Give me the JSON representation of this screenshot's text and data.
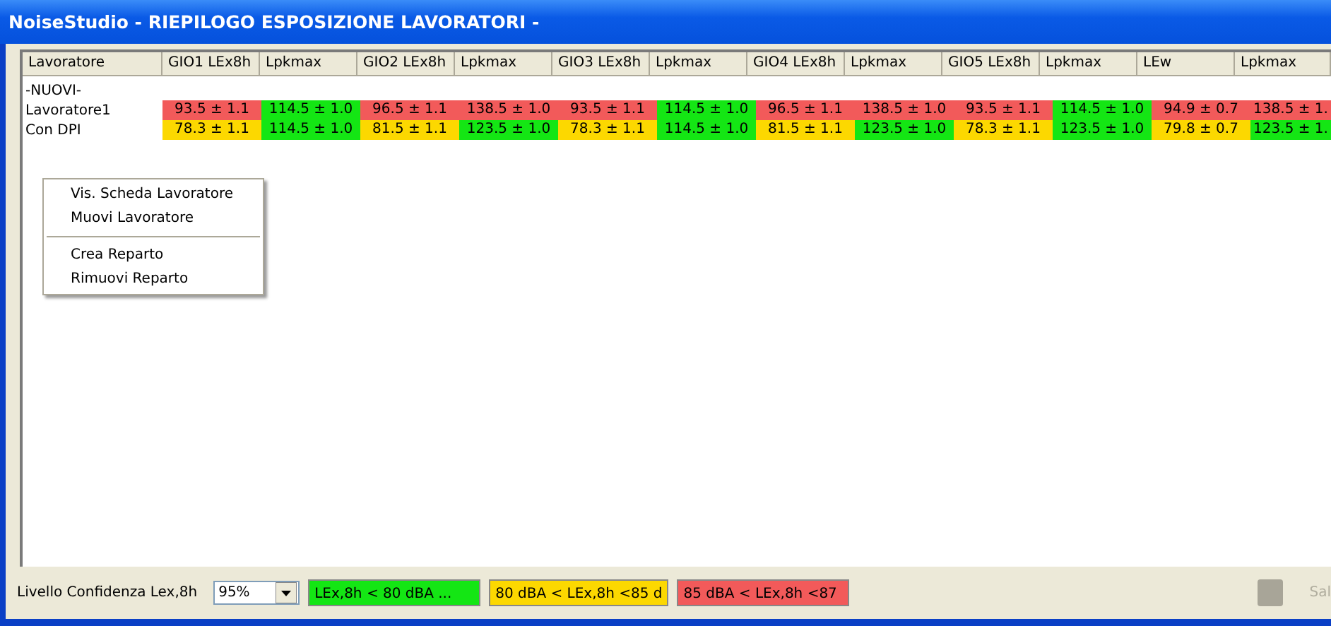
{
  "window": {
    "title": "NoiseStudio - RIEPILOGO ESPOSIZIONE LAVORATORI -"
  },
  "table": {
    "columns": [
      "Lavoratore",
      "GIO1 LEx8h",
      "Lpkmax",
      "GIO2 LEx8h",
      "Lpkmax",
      "GIO3 LEx8h",
      "Lpkmax",
      "GIO4 LEx8h",
      "Lpkmax",
      "GIO5 LEx8h",
      "Lpkmax",
      "LEw",
      "Lpkmax"
    ],
    "rows": [
      {
        "kind": "group",
        "name": "-NUOVI-"
      },
      {
        "kind": "worker",
        "name": "Lavoratore1",
        "cells": [
          {
            "text": "93.5 ± 1.1",
            "color": "#f25a5a"
          },
          {
            "text": "114.5 ± 1.0",
            "color": "#14e614"
          },
          {
            "text": "96.5 ± 1.1",
            "color": "#f25a5a"
          },
          {
            "text": "138.5 ± 1.0",
            "color": "#f25a5a"
          },
          {
            "text": "93.5 ± 1.1",
            "color": "#f25a5a"
          },
          {
            "text": "114.5 ± 1.0",
            "color": "#14e614"
          },
          {
            "text": "96.5 ± 1.1",
            "color": "#f25a5a"
          },
          {
            "text": "138.5 ± 1.0",
            "color": "#f25a5a"
          },
          {
            "text": "93.5 ± 1.1",
            "color": "#f25a5a"
          },
          {
            "text": "114.5 ± 1.0",
            "color": "#14e614"
          },
          {
            "text": "94.9 ± 0.7",
            "color": "#f25a5a"
          },
          {
            "text": "138.5 ± 1.",
            "color": "#f25a5a"
          }
        ]
      },
      {
        "kind": "worker",
        "name": "Con DPI",
        "cells": [
          {
            "text": "78.3 ± 1.1",
            "color": "#fcd800"
          },
          {
            "text": "114.5 ± 1.0",
            "color": "#14e614"
          },
          {
            "text": "81.5 ± 1.1",
            "color": "#fcd800"
          },
          {
            "text": "123.5 ± 1.0",
            "color": "#14e614"
          },
          {
            "text": "78.3 ± 1.1",
            "color": "#fcd800"
          },
          {
            "text": "114.5 ± 1.0",
            "color": "#14e614"
          },
          {
            "text": "81.5 ± 1.1",
            "color": "#fcd800"
          },
          {
            "text": "123.5 ± 1.0",
            "color": "#14e614"
          },
          {
            "text": "78.3 ± 1.1",
            "color": "#fcd800"
          },
          {
            "text": "123.5 ± 1.0",
            "color": "#14e614"
          },
          {
            "text": "79.8 ± 0.7",
            "color": "#fcd800"
          },
          {
            "text": "123.5 ± 1.",
            "color": "#14e614"
          }
        ]
      }
    ]
  },
  "context_menu": [
    {
      "kind": "item",
      "label": "Vis. Scheda Lavoratore"
    },
    {
      "kind": "item",
      "label": "Muovi Lavoratore"
    },
    {
      "kind": "separator"
    },
    {
      "kind": "item",
      "label": "Crea Reparto"
    },
    {
      "kind": "item",
      "label": "Rimuovi Reparto"
    }
  ],
  "footer": {
    "confidence_label": "Livello Confidenza Lex,8h",
    "confidence_value": "95%",
    "legend": [
      {
        "text": "LEx,8h < 80 dBA ...",
        "color": "#14e614"
      },
      {
        "text": "80 dBA < LEx,8h <85 d",
        "color": "#fcd800"
      },
      {
        "text": "85 dBA < LEx,8h <87",
        "color": "#f25a5a"
      }
    ],
    "save_button": {
      "label": "Sal",
      "disabled": true
    }
  }
}
